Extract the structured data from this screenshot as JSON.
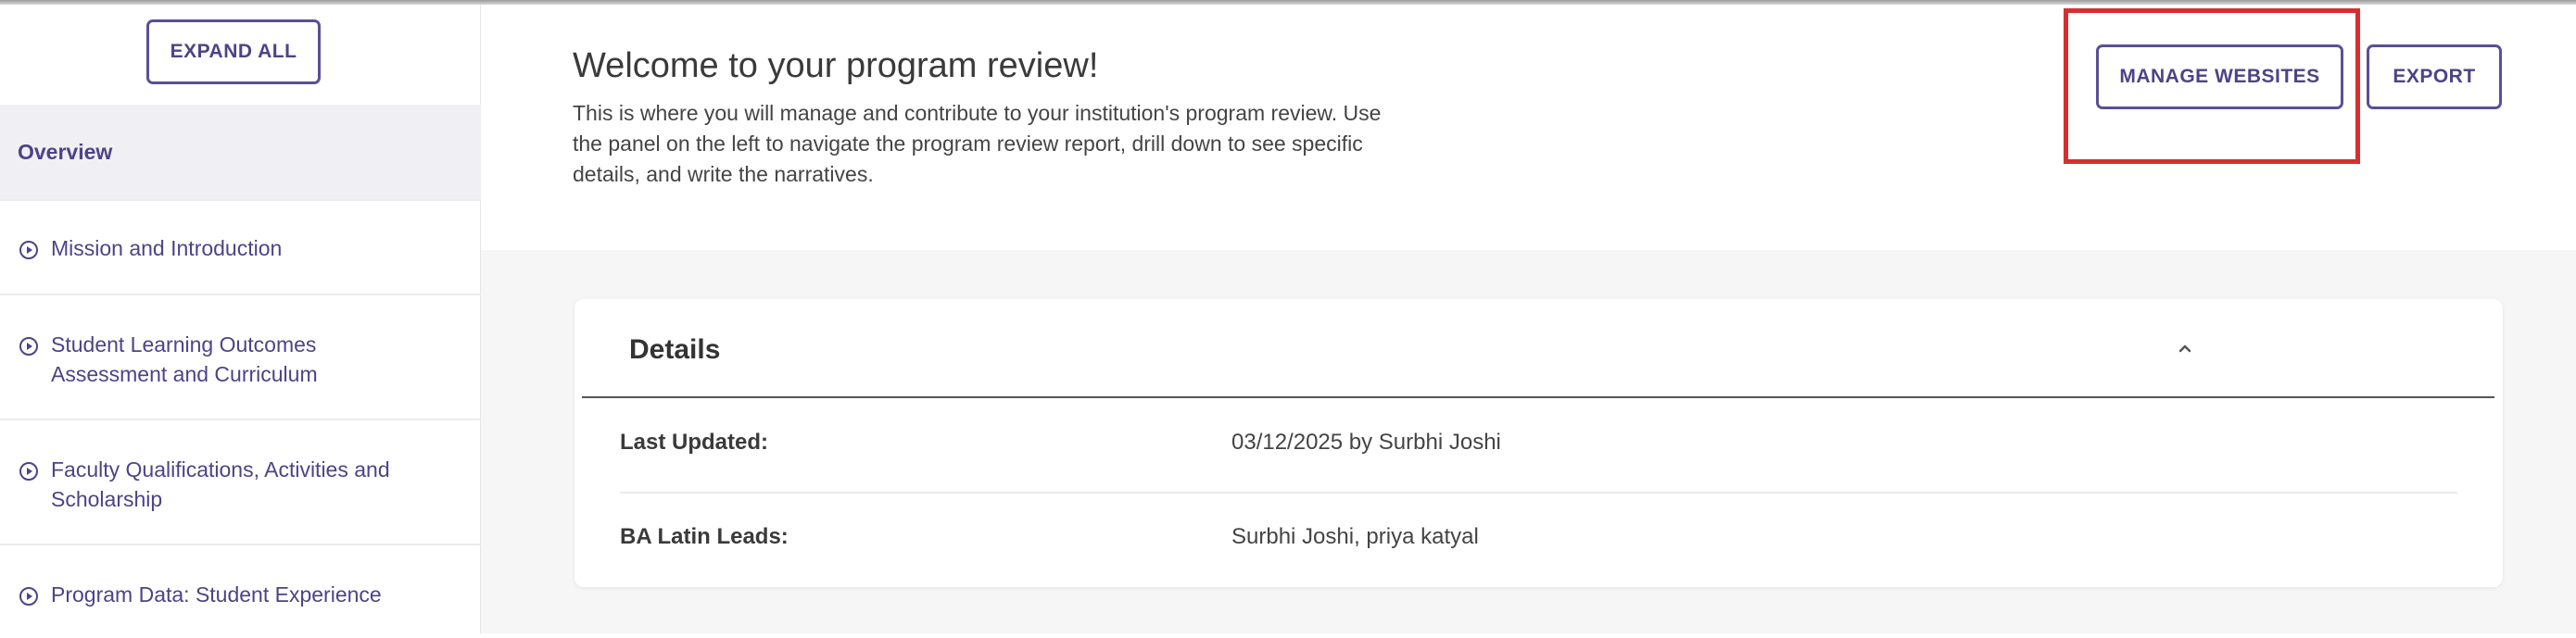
{
  "sidebar": {
    "expand_all_label": "EXPAND ALL",
    "items": [
      {
        "label": "Overview",
        "active": true
      },
      {
        "label": "Mission and Introduction",
        "active": false
      },
      {
        "label": "Student Learning Outcomes Assessment and Curriculum",
        "active": false
      },
      {
        "label": "Faculty Qualifications, Activities and Scholarship",
        "active": false
      },
      {
        "label": "Program Data: Student Experience",
        "active": false
      }
    ]
  },
  "header": {
    "title": "Welcome to your program review!",
    "description": "This is where you will manage and contribute to your institution's program review. Use the panel on the left to navigate the program review report, drill down to see specific details, and write the narratives.",
    "manage_websites_label": "MANAGE WEBSITES",
    "export_label": "EXPORT"
  },
  "details": {
    "title": "Details",
    "rows": [
      {
        "label": "Last Updated:",
        "value": "03/12/2025 by Surbhi Joshi"
      },
      {
        "label": "BA Latin Leads:",
        "value": "Surbhi Joshi, priya katyal"
      }
    ]
  },
  "colors": {
    "accent": "#4e4386",
    "highlight": "#d62f2f",
    "active_bg": "#f0eff4"
  },
  "icons": {
    "nav_item": "play-circle-icon",
    "collapse": "chevron-up-icon"
  }
}
